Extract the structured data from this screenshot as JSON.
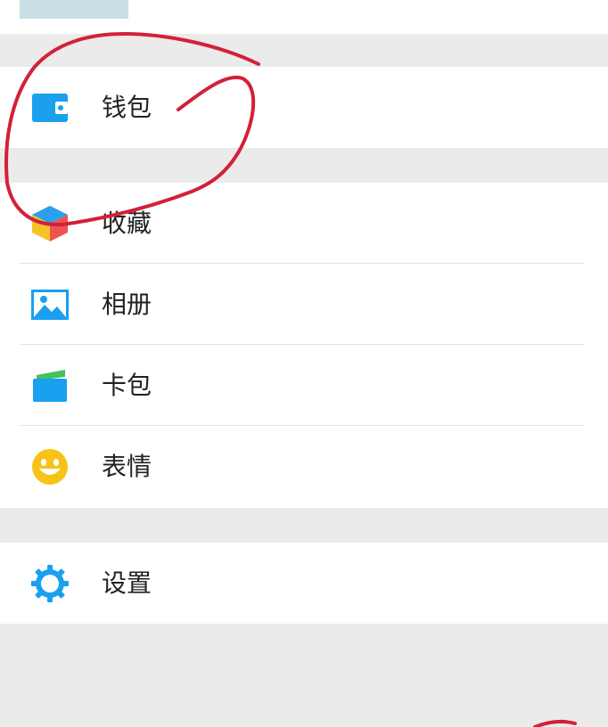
{
  "menu": {
    "wallet": {
      "label": "钱包",
      "icon": "wallet-icon"
    },
    "favorites": {
      "label": "收藏",
      "icon": "cube-icon"
    },
    "photos": {
      "label": "相册",
      "icon": "photo-icon"
    },
    "cards": {
      "label": "卡包",
      "icon": "card-icon"
    },
    "stickers": {
      "label": "表情",
      "icon": "smiley-icon"
    },
    "settings": {
      "label": "设置",
      "icon": "gear-icon"
    }
  },
  "colors": {
    "accent_blue": "#1aa0ee",
    "annotation_red": "#d3203a",
    "section_gap": "#ebebeb"
  }
}
